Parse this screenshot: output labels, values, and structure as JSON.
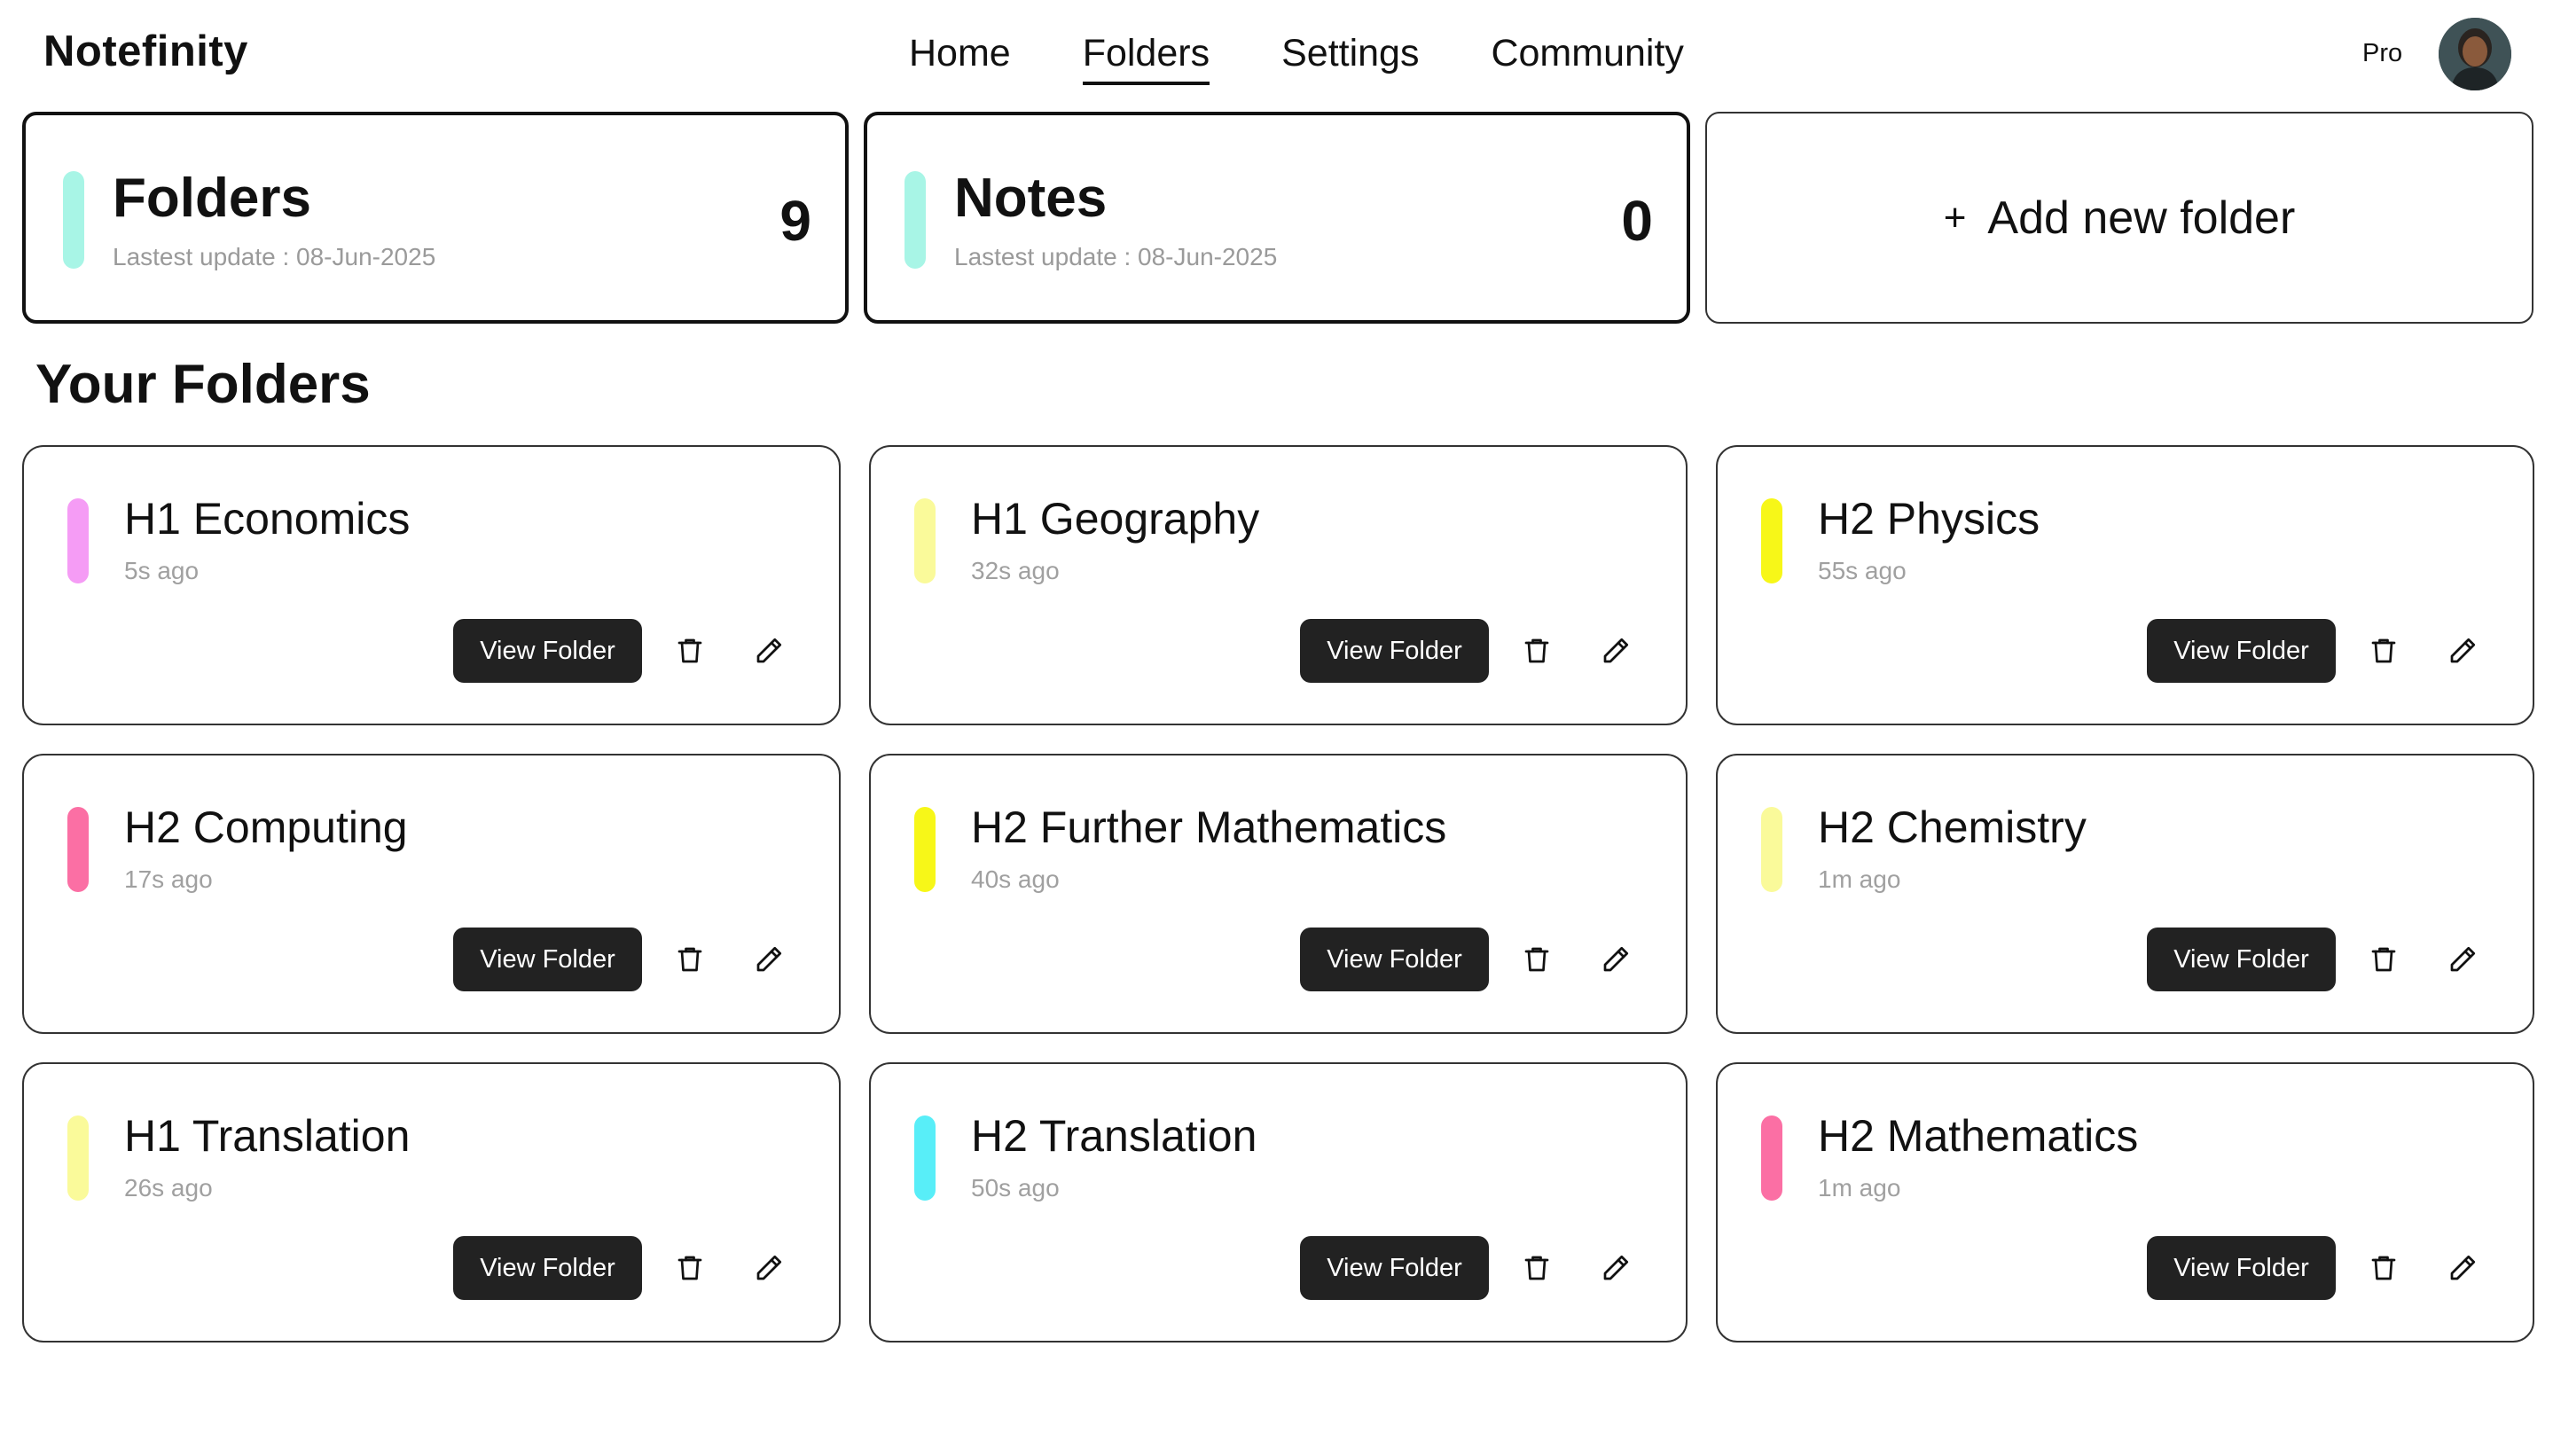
{
  "brand": "Notefinity",
  "nav": {
    "items": [
      "Home",
      "Folders",
      "Settings",
      "Community"
    ],
    "active": "Folders"
  },
  "user": {
    "plan_label": "Pro",
    "avatar_icon": "user-avatar"
  },
  "stats": {
    "folders": {
      "title": "Folders",
      "subtitle": "Lastest update : 08-Jun-2025",
      "count": "9",
      "accent": "#a8f5e6"
    },
    "notes": {
      "title": "Notes",
      "subtitle": "Lastest update : 08-Jun-2025",
      "count": "0",
      "accent": "#a8f5e6"
    }
  },
  "add_folder": {
    "icon": "plus-icon",
    "plus": "+",
    "label": "Add new folder"
  },
  "section_title": "Your Folders",
  "folder_actions": {
    "view_label": "View Folder",
    "delete_icon": "trash-icon",
    "edit_icon": "pencil-icon"
  },
  "folders": [
    {
      "name": "H1 Economics",
      "time": "5s ago",
      "color": "#f59cf5"
    },
    {
      "name": "H1 Geography",
      "time": "32s ago",
      "color": "#fafa9a"
    },
    {
      "name": "H2 Physics",
      "time": "55s ago",
      "color": "#f7f718"
    },
    {
      "name": "H2 Computing",
      "time": "17s ago",
      "color": "#fb6fa4"
    },
    {
      "name": "H2 Further Mathematics",
      "time": "40s ago",
      "color": "#f7f718"
    },
    {
      "name": "H2 Chemistry",
      "time": "1m ago",
      "color": "#fafa9a"
    },
    {
      "name": "H1 Translation",
      "time": "26s ago",
      "color": "#fafa9a"
    },
    {
      "name": "H2 Translation",
      "time": "50s ago",
      "color": "#58eef8"
    },
    {
      "name": "H2 Mathematics",
      "time": "1m ago",
      "color": "#fb6fa4"
    }
  ]
}
